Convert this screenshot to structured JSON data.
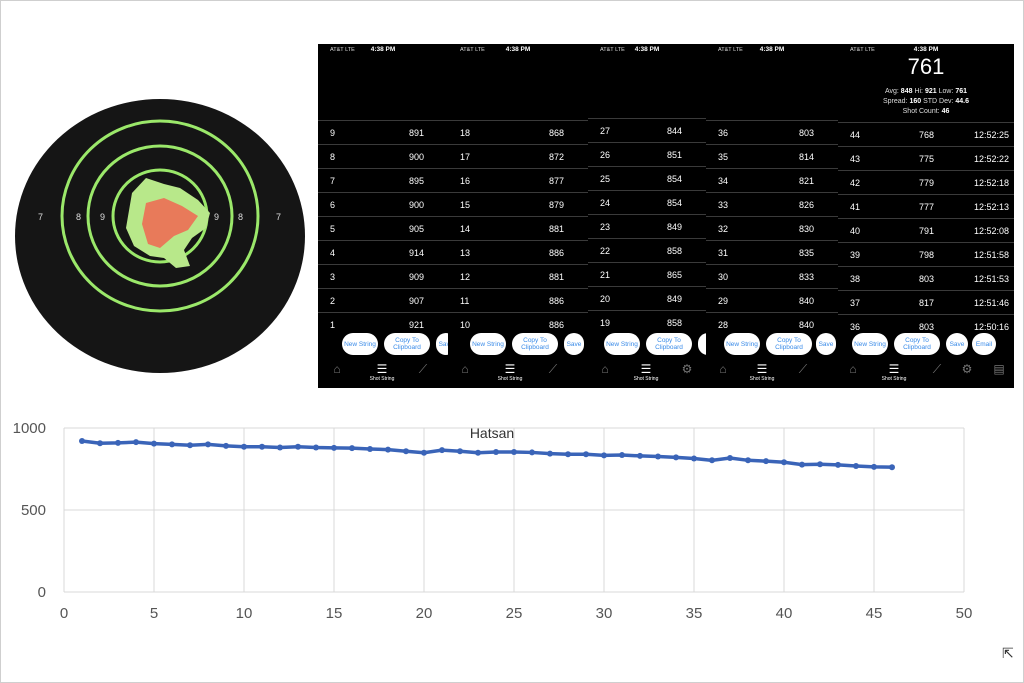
{
  "status": {
    "carrier": "AT&T  LTE",
    "time": "4:38 PM"
  },
  "screens": [
    {
      "rows": [
        [
          "9",
          "891"
        ],
        [
          "8",
          "900"
        ],
        [
          "7",
          "895"
        ],
        [
          "6",
          "900"
        ],
        [
          "5",
          "905"
        ],
        [
          "4",
          "914"
        ],
        [
          "3",
          "909"
        ],
        [
          "2",
          "907"
        ],
        [
          "1",
          "921"
        ]
      ]
    },
    {
      "rows": [
        [
          "18",
          "868"
        ],
        [
          "17",
          "872"
        ],
        [
          "16",
          "877"
        ],
        [
          "15",
          "879"
        ],
        [
          "14",
          "881"
        ],
        [
          "13",
          "886"
        ],
        [
          "12",
          "881"
        ],
        [
          "11",
          "886"
        ],
        [
          "10",
          "886"
        ]
      ]
    },
    {
      "rows": [
        [
          "27",
          "844"
        ],
        [
          "26",
          "851"
        ],
        [
          "25",
          "854"
        ],
        [
          "24",
          "854"
        ],
        [
          "23",
          "849"
        ],
        [
          "22",
          "858"
        ],
        [
          "21",
          "865"
        ],
        [
          "20",
          "849"
        ],
        [
          "19",
          "858"
        ]
      ]
    },
    {
      "rows": [
        [
          "36",
          "803"
        ],
        [
          "35",
          "814"
        ],
        [
          "34",
          "821"
        ],
        [
          "33",
          "826"
        ],
        [
          "32",
          "830"
        ],
        [
          "31",
          "835"
        ],
        [
          "30",
          "833"
        ],
        [
          "29",
          "840"
        ],
        [
          "28",
          "840"
        ]
      ]
    },
    {
      "rows": [
        [
          "44",
          "768",
          "12:52:25"
        ],
        [
          "43",
          "775",
          "12:52:22"
        ],
        [
          "42",
          "779",
          "12:52:18"
        ],
        [
          "41",
          "777",
          "12:52:13"
        ],
        [
          "40",
          "791",
          "12:52:08"
        ],
        [
          "39",
          "798",
          "12:51:58"
        ],
        [
          "38",
          "803",
          "12:51:53"
        ],
        [
          "37",
          "817",
          "12:51:46"
        ],
        [
          "36",
          "803",
          "12:50:16"
        ]
      ]
    }
  ],
  "summary": {
    "last": "761",
    "avg_label": "Avg:",
    "avg": "848",
    "hi_label": "Hi:",
    "hi": "921",
    "low_label": "Low:",
    "low": "761",
    "spread_label": "Spread:",
    "spread": "160",
    "std_label": "STD Dev:",
    "std": "44.6",
    "count_label": "Shot Count:",
    "count": "46"
  },
  "buttons": {
    "new_string": "New String",
    "copy": "Copy To Clipboard",
    "save": "Save",
    "email": "Email"
  },
  "tabs": {
    "shot_string": "Shot String"
  },
  "target": {
    "ring_left_7": "7",
    "ring_left_8": "8",
    "ring_left_9": "9",
    "ring_right_8": "8",
    "ring_right_7": "7",
    "ring_right_9": "9"
  },
  "colors": {
    "line": "#3a64b8",
    "target_ring": "#9be86a",
    "impact": "#e87a5a"
  },
  "chart_data": {
    "type": "line",
    "title": "Hatsan",
    "x": [
      1,
      2,
      3,
      4,
      5,
      6,
      7,
      8,
      9,
      10,
      11,
      12,
      13,
      14,
      15,
      16,
      17,
      18,
      19,
      20,
      21,
      22,
      23,
      24,
      25,
      26,
      27,
      28,
      29,
      30,
      31,
      32,
      33,
      34,
      35,
      36,
      37,
      38,
      39,
      40,
      41,
      42,
      43,
      44,
      45,
      46
    ],
    "series": [
      {
        "values": [
          921,
          907,
          909,
          914,
          905,
          900,
          895,
          900,
          891,
          886,
          886,
          881,
          886,
          881,
          879,
          877,
          872,
          868,
          858,
          849,
          865,
          858,
          849,
          854,
          854,
          851,
          844,
          840,
          840,
          833,
          835,
          830,
          826,
          821,
          814,
          803,
          817,
          803,
          798,
          791,
          777,
          779,
          775,
          768,
          763,
          761
        ]
      }
    ],
    "xlim": [
      0,
      50
    ],
    "ylim": [
      0,
      1000
    ],
    "xticks": [
      0,
      5,
      10,
      15,
      20,
      25,
      30,
      35,
      40,
      45,
      50
    ],
    "yticks": [
      0,
      500,
      1000
    ],
    "grid": true
  }
}
